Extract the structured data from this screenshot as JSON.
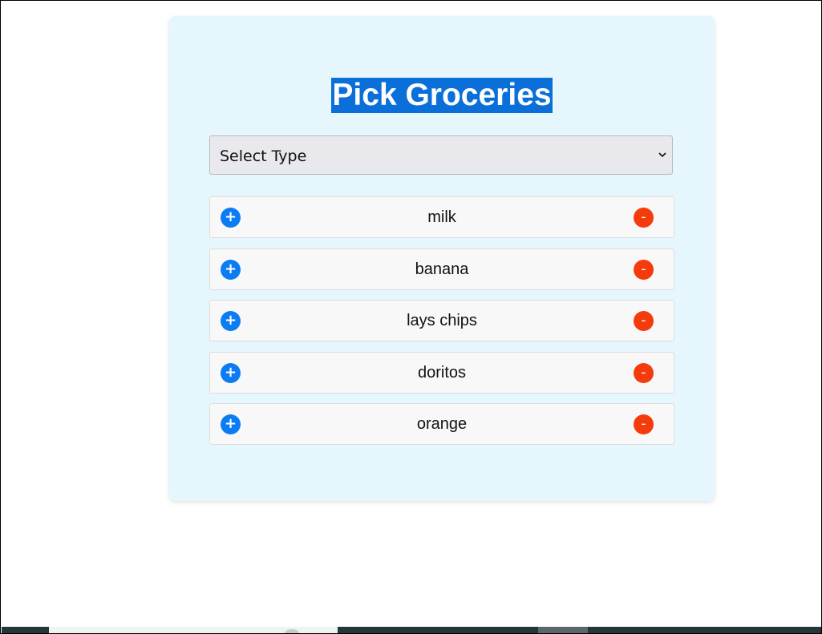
{
  "page": {
    "title": "Pick Groceries"
  },
  "select": {
    "value": "Select Type"
  },
  "groceries": [
    {
      "name": "milk",
      "add_label": "+",
      "remove_label": "-"
    },
    {
      "name": "banana",
      "add_label": "+",
      "remove_label": "-"
    },
    {
      "name": "lays chips",
      "add_label": "+",
      "remove_label": "-"
    },
    {
      "name": "doritos",
      "add_label": "+",
      "remove_label": "-"
    },
    {
      "name": "orange",
      "add_label": "+",
      "remove_label": "-"
    }
  ],
  "colors": {
    "card_background": "#e6f6fd",
    "title_highlight": "#0a6fd8",
    "add_button": "#0c7cf2",
    "remove_button": "#f53a0b"
  },
  "icons": {
    "select_arrow": "chevron-down-icon",
    "add": "plus-icon",
    "remove": "minus-icon"
  }
}
